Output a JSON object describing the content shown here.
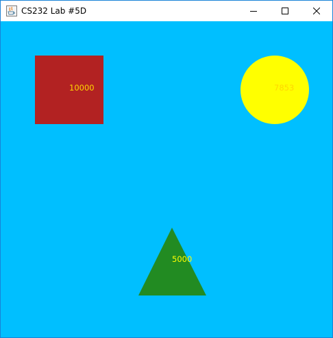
{
  "window": {
    "title": "CS232 Lab #5D",
    "icons": {
      "app": "java-cup-icon",
      "minimize": "minimize-icon",
      "maximize": "maximize-icon",
      "close": "close-icon"
    }
  },
  "canvas": {
    "background": "#00bfff",
    "shapes": [
      {
        "kind": "square",
        "fill": "#b22222",
        "label": "10000",
        "label_color": "#ffd700"
      },
      {
        "kind": "circle",
        "fill": "#ffff00",
        "label": "7853",
        "label_color": "#ffd700"
      },
      {
        "kind": "triangle",
        "fill": "#228b22",
        "label": "5000",
        "label_color": "#ffff00"
      }
    ]
  }
}
